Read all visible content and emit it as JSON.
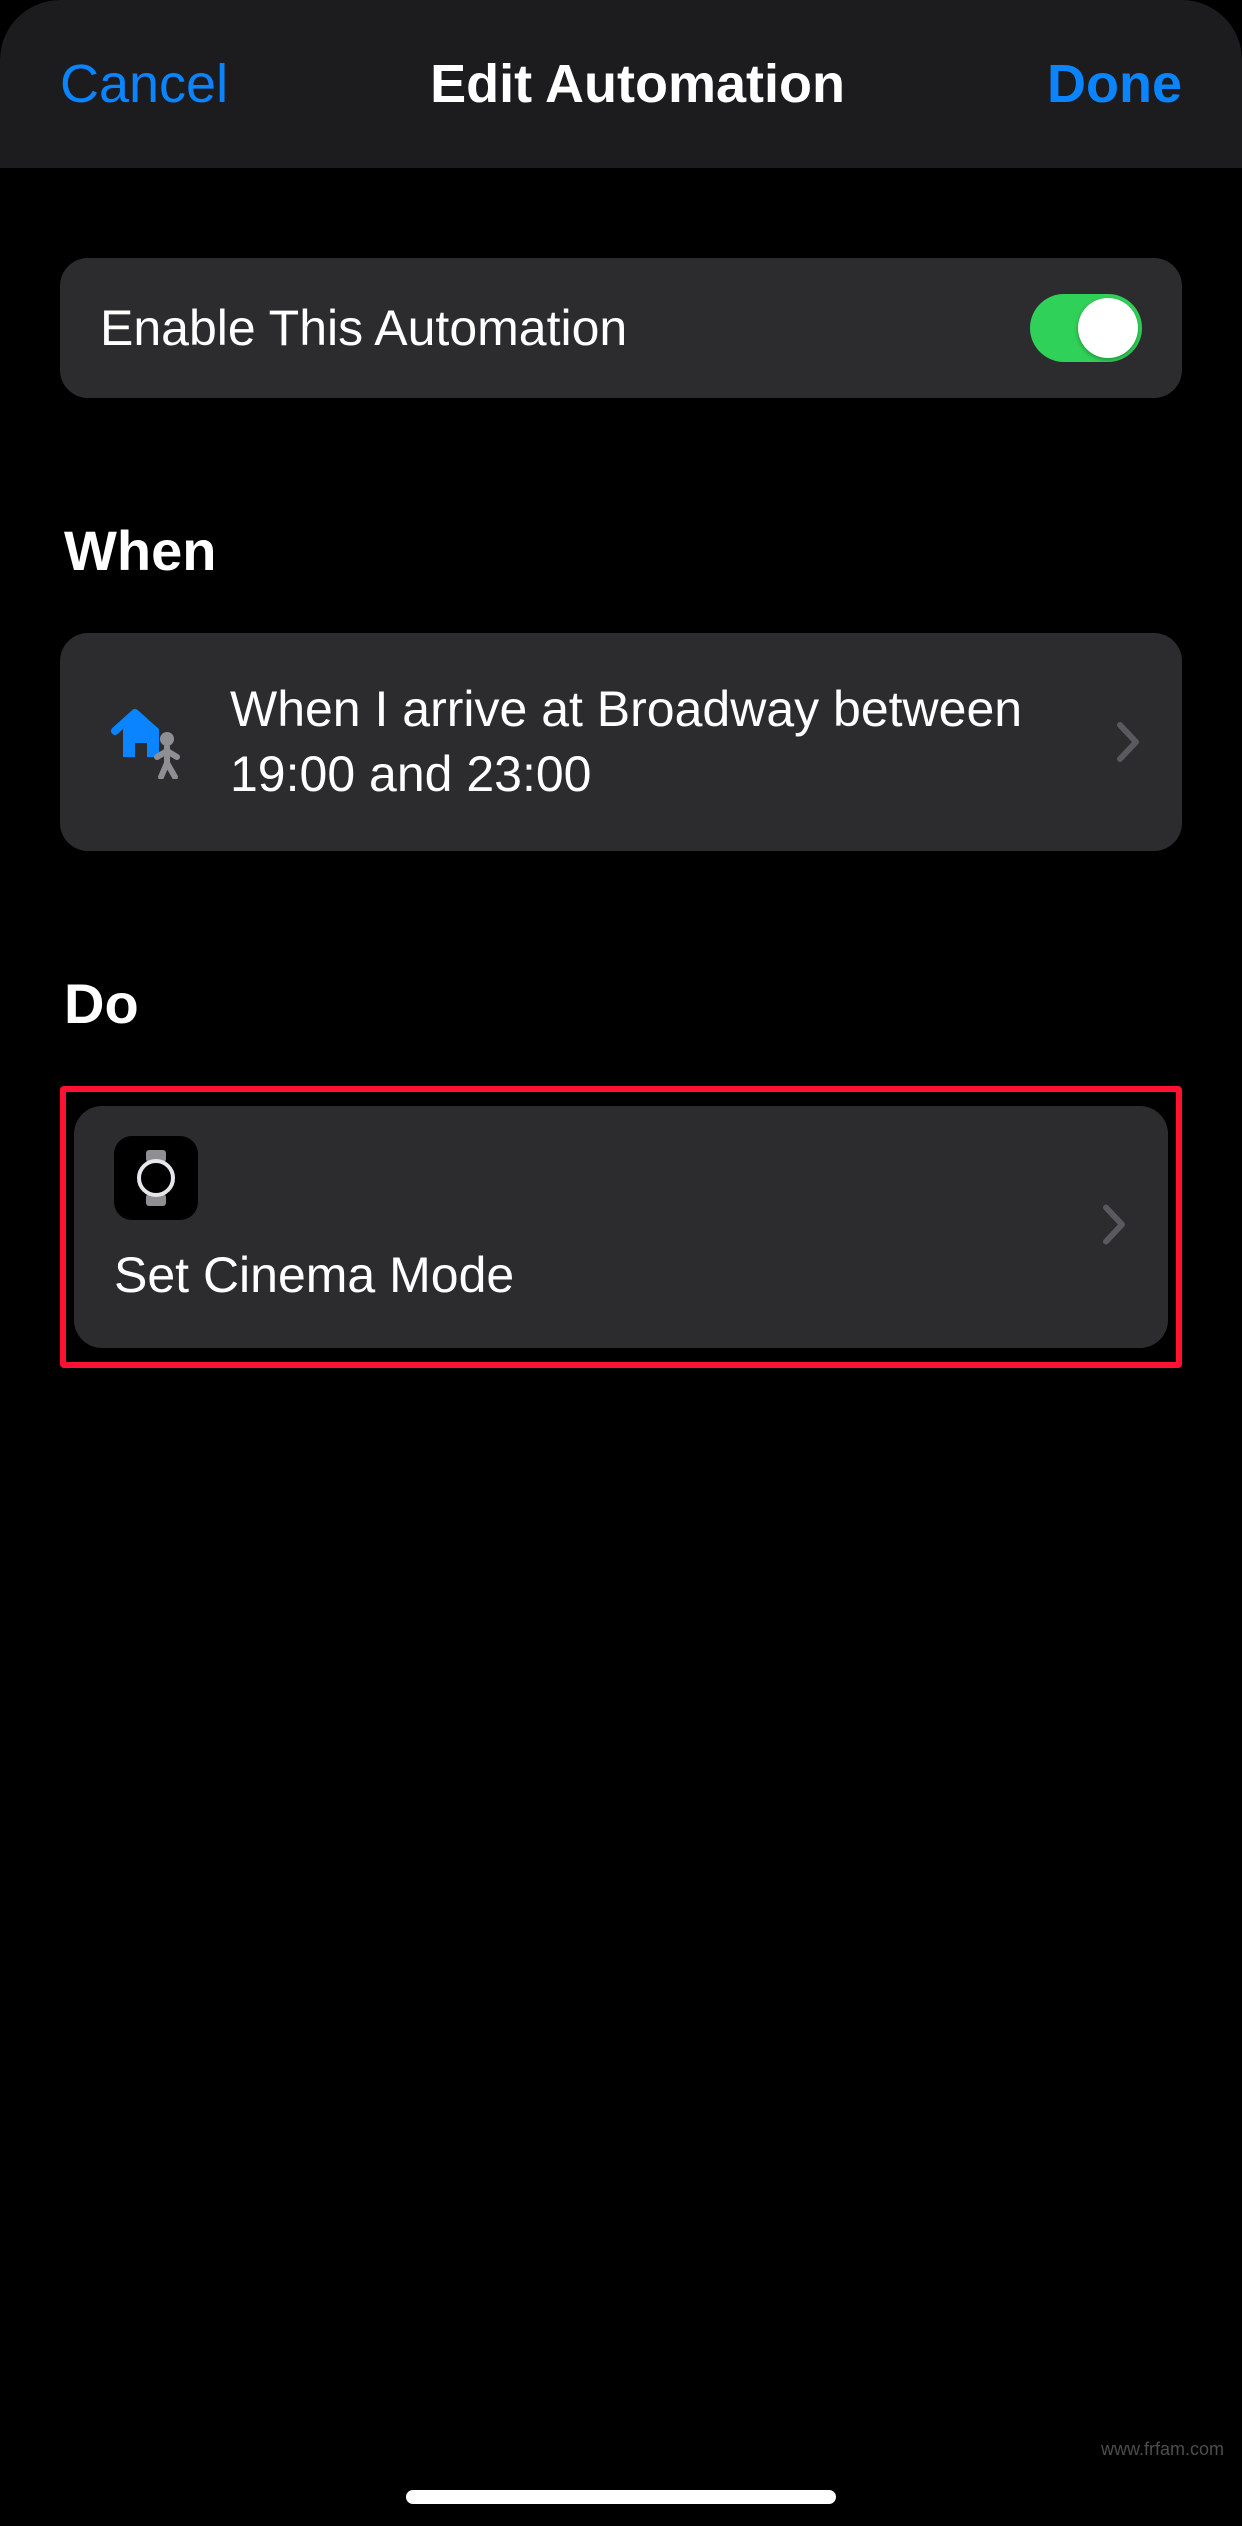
{
  "nav": {
    "cancel": "Cancel",
    "title": "Edit Automation",
    "done": "Done"
  },
  "enable": {
    "label": "Enable This Automation",
    "on": true
  },
  "when": {
    "header": "When",
    "row": {
      "text": "When I arrive at Broadway between 19:00 and 23:00"
    }
  },
  "do": {
    "header": "Do",
    "row": {
      "title": "Set Cinema Mode"
    }
  },
  "watermark": "www.frfam.com"
}
